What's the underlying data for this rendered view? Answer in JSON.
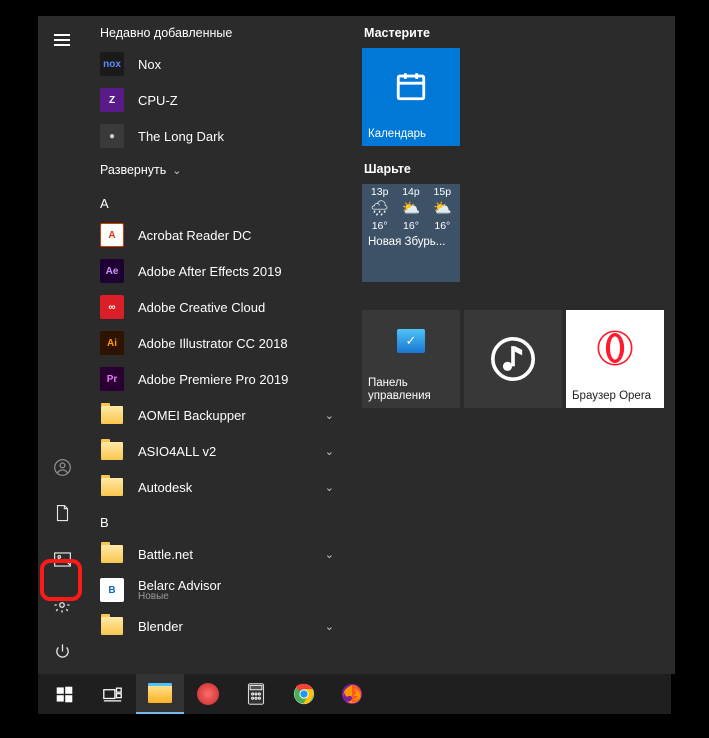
{
  "sections": {
    "recent": "Недавно добавленные",
    "expand": "Развернуть"
  },
  "recentApps": [
    {
      "name": "Nox",
      "iconBg": "#1a1a1a",
      "iconFg": "#5b8cff",
      "iconText": "nox"
    },
    {
      "name": "CPU-Z",
      "iconBg": "#5a1a8a",
      "iconFg": "#fff",
      "iconText": "Z"
    },
    {
      "name": "The Long Dark",
      "iconBg": "#3a3a3a",
      "iconFg": "#ccc",
      "iconText": "●"
    }
  ],
  "letterA": "A",
  "appsA": [
    {
      "name": "Acrobat Reader DC",
      "iconBg": "#fff",
      "iconFg": "#d83b01",
      "iconText": "A",
      "border": true
    },
    {
      "name": "Adobe After Effects 2019",
      "iconBg": "#1f0033",
      "iconFg": "#cf96ff",
      "iconText": "Ae"
    },
    {
      "name": "Adobe Creative Cloud",
      "iconBg": "#da1f26",
      "iconFg": "#fff",
      "iconText": "∞"
    },
    {
      "name": "Adobe Illustrator CC 2018",
      "iconBg": "#2e1400",
      "iconFg": "#ff9a00",
      "iconText": "Ai"
    },
    {
      "name": "Adobe Premiere Pro 2019",
      "iconBg": "#2a0033",
      "iconFg": "#ea77ff",
      "iconText": "Pr"
    },
    {
      "name": "AOMEI Backupper",
      "folder": true,
      "expand": true
    },
    {
      "name": "ASIO4ALL v2",
      "folder": true,
      "expand": true
    },
    {
      "name": "Autodesk",
      "folder": true,
      "expand": true
    }
  ],
  "letterB": "B",
  "appsB": [
    {
      "name": "Battle.net",
      "folder": true,
      "expand": true
    },
    {
      "name": "Belarc Advisor",
      "iconBg": "#fff",
      "iconFg": "#1565c0",
      "iconText": "B",
      "sub": "Новые"
    },
    {
      "name": "Blender",
      "folder": true,
      "expand": true
    }
  ],
  "tileGroups": {
    "g1": "Мастерите",
    "g2": "Шарьте"
  },
  "tiles": {
    "calendar": "Календарь",
    "weatherTitle": "Новая Збурь...",
    "weather": {
      "times": [
        "13p",
        "14p",
        "15p"
      ],
      "temps": [
        "16°",
        "16°",
        "16°"
      ]
    },
    "controlPanel1": "Панель",
    "controlPanel2": "управления",
    "opera": "Браузер Opera"
  },
  "rail": {
    "user": "user-icon",
    "documents": "document-icon",
    "pictures": "picture-icon",
    "settings": "gear-icon",
    "power": "power-icon"
  }
}
